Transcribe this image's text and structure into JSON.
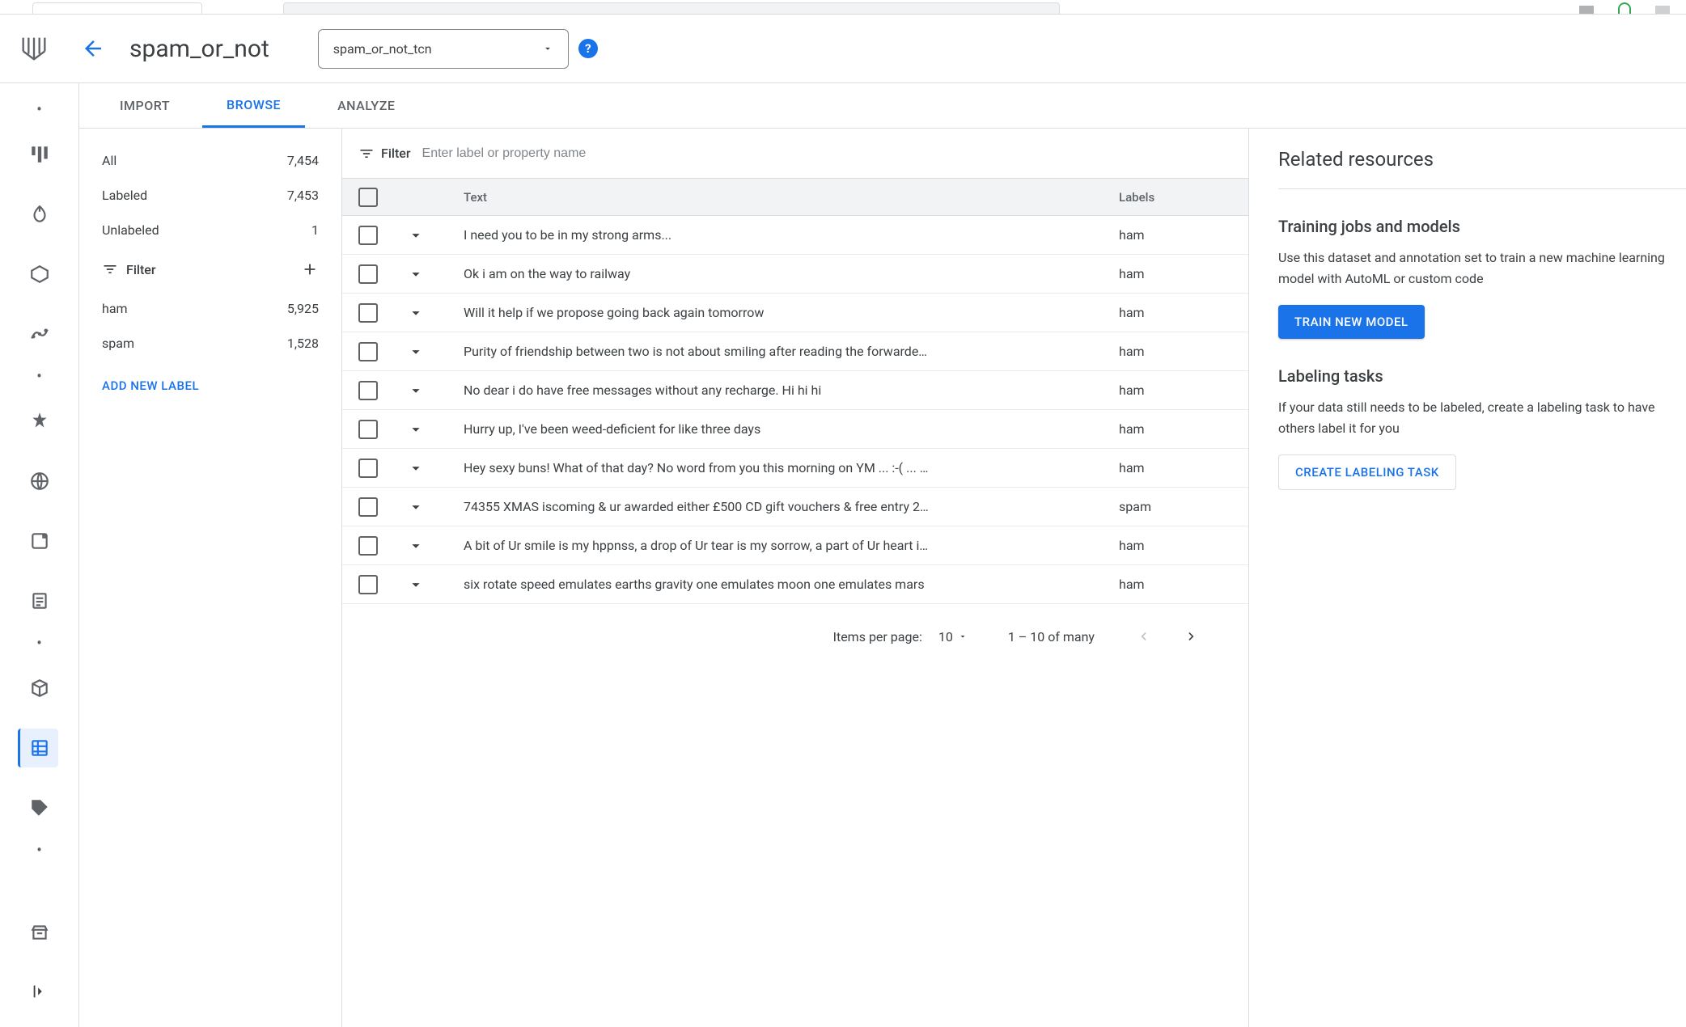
{
  "header": {
    "title": "spam_or_not",
    "annotation_set": "spam_or_not_tcn"
  },
  "tabs": {
    "import": "IMPORT",
    "browse": "BROWSE",
    "analyze": "ANALYZE"
  },
  "stats": {
    "all_label": "All",
    "all_count": "7,454",
    "labeled_label": "Labeled",
    "labeled_count": "7,453",
    "unlabeled_label": "Unlabeled",
    "unlabeled_count": "1"
  },
  "filter": {
    "heading": "Filter",
    "labels": [
      {
        "name": "ham",
        "count": "5,925"
      },
      {
        "name": "spam",
        "count": "1,528"
      }
    ],
    "add_label": "ADD NEW LABEL"
  },
  "table": {
    "filter_label": "Filter",
    "filter_placeholder": "Enter label or property name",
    "columns": {
      "text": "Text",
      "labels": "Labels"
    },
    "rows": [
      {
        "text": "I need you to be in my strong arms...",
        "label": "ham"
      },
      {
        "text": "Ok i am on the way to railway",
        "label": "ham"
      },
      {
        "text": "Will it help if we propose going back again tomorrow",
        "label": "ham"
      },
      {
        "text": "Purity of friendship between two is not about smiling after reading the forwarde…",
        "label": "ham"
      },
      {
        "text": "No dear i do have free messages without any recharge. Hi hi hi",
        "label": "ham"
      },
      {
        "text": "Hurry up, I've been weed-deficient for like three days",
        "label": "ham"
      },
      {
        "text": "Hey sexy buns! What of that day? No word from you this morning on YM ... :-( ... …",
        "label": "ham"
      },
      {
        "text": "74355 XMAS iscoming & ur awarded either £500 CD gift vouchers & free entry 2…",
        "label": "spam"
      },
      {
        "text": "A bit of Ur smile is my hppnss, a drop of Ur tear is my sorrow, a part of Ur heart i…",
        "label": "ham"
      },
      {
        "text": "six rotate speed emulates earths gravity one emulates moon one emulates mars",
        "label": "ham"
      }
    ]
  },
  "pager": {
    "items_per_page_label": "Items per page:",
    "items_per_page_value": "10",
    "range": "1 – 10 of many"
  },
  "right": {
    "title": "Related resources",
    "training_title": "Training jobs and models",
    "training_text": "Use this dataset and annotation set to train a new machine learning model with AutoML or custom code",
    "train_button": "TRAIN NEW MODEL",
    "labeling_title": "Labeling tasks",
    "labeling_text": "If your data still needs to be labeled, create a labeling task to have others label it for you",
    "labeling_button": "CREATE LABELING TASK"
  }
}
